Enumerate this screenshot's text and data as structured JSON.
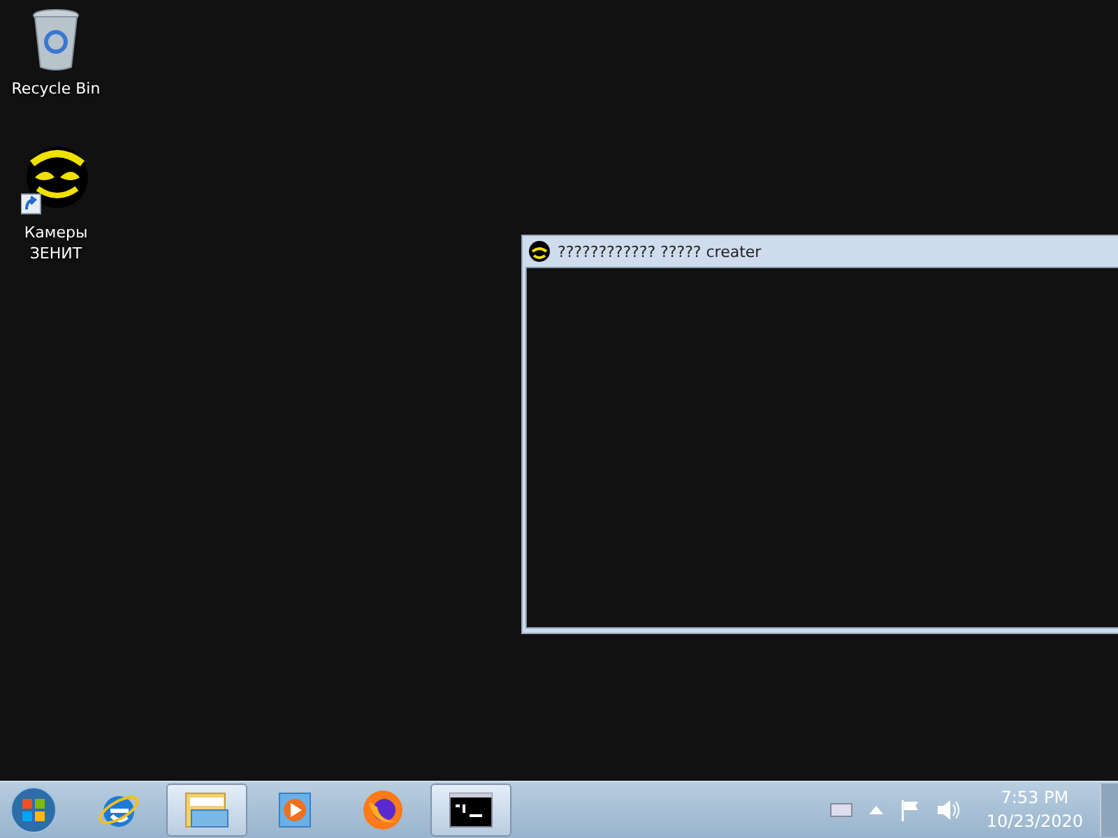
{
  "desktop_icons": [
    {
      "kind": "recycle",
      "label": "Recycle Bin"
    },
    {
      "kind": "shortcut",
      "label": "Камеры ЗЕНИТ"
    }
  ],
  "window": {
    "title": "???????????? ????? creater"
  },
  "taskbar": {
    "items": [
      {
        "kind": "ie",
        "open": false
      },
      {
        "kind": "explorer",
        "open": true
      },
      {
        "kind": "media",
        "open": false
      },
      {
        "kind": "firefox",
        "open": false
      },
      {
        "kind": "console",
        "open": true
      }
    ],
    "clock": {
      "time": "7:53 PM",
      "date": "10/23/2020"
    }
  }
}
